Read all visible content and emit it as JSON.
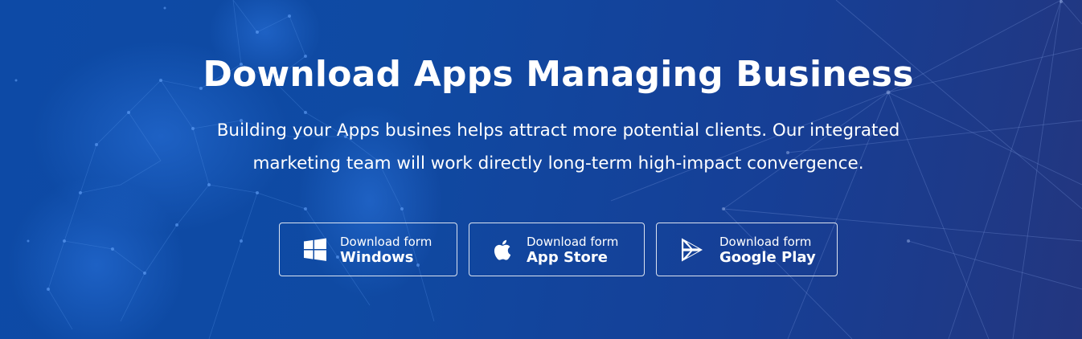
{
  "hero": {
    "title": "Download Apps Managing Business",
    "subtitle_line1": "Building your Apps busines helps attract more potential clients. Our integrated",
    "subtitle_line2": "marketing team will work directly long-term high-impact convergence."
  },
  "buttons": [
    {
      "small_label": "Download form",
      "big_label": "Windows",
      "icon": "windows-icon"
    },
    {
      "small_label": "Download form",
      "big_label": "App Store",
      "icon": "apple-icon"
    },
    {
      "small_label": "Download form",
      "big_label": "Google Play",
      "icon": "google-play-icon"
    }
  ],
  "colors": {
    "background_start": "#0d4aa6",
    "background_end": "#23367f",
    "text": "#ffffff",
    "button_border": "#ffffff"
  }
}
